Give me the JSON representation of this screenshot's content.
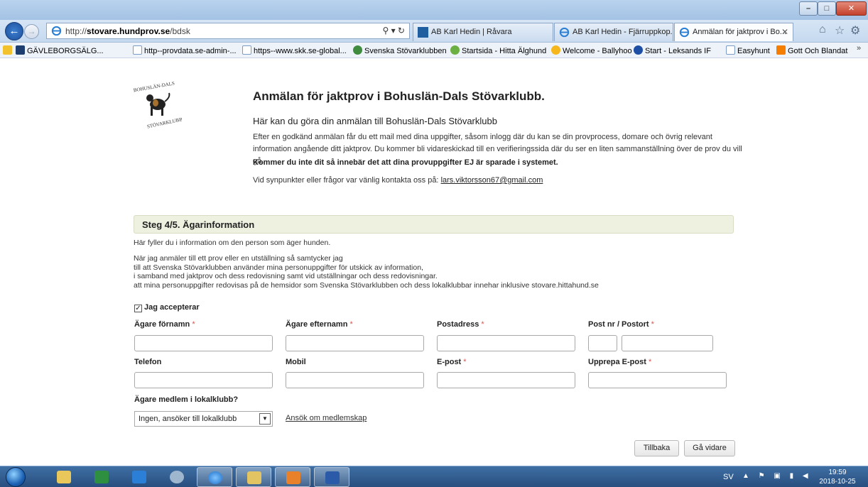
{
  "browser": {
    "url_host": "stovare.hundprov.se",
    "url_prefix": "http://",
    "url_path": "/bdsk",
    "tabs": [
      {
        "label": "AB Karl Hedin | Råvara"
      },
      {
        "label": "AB Karl Hedin - Fjärruppkop..."
      },
      {
        "label": "Anmälan för jaktprov i Bo..."
      }
    ],
    "favorites": [
      {
        "label": "GÄVLEBORGSÄLG..."
      },
      {
        "label": "http--provdata.se-admin-..."
      },
      {
        "label": "https--www.skk.se-global..."
      },
      {
        "label": "Svenska Stövarklubben"
      },
      {
        "label": "Startsida - Hitta Älghund"
      },
      {
        "label": "Welcome - Ballyhoo"
      },
      {
        "label": "Start - Leksands IF"
      },
      {
        "label": "Easyhunt"
      },
      {
        "label": "Gott Och Blandat"
      }
    ]
  },
  "page": {
    "title": "Anmälan för jaktprov i Bohuslän-Dals Stövarklubb.",
    "subtitle": "Här kan du göra din anmälan till Bohuslän-Dals Stövarklubb",
    "intro": "Efter en godkänd anmälan får du ett mail med dina uppgifter, såsom inlogg där du kan se din provprocess, domare och övrig relevant information angående ditt jaktprov. Du kommer bli vidareskickad till en verifieringssida där du ser en liten sammanställning över de prov du vill gå.",
    "warning": "Kommer du inte dit så innebär det att dina provuppgifter EJ är sparade i systemet.",
    "contact_prefix": "Vid synpunkter eller frågor var vänlig kontakta oss på: ",
    "contact_email": "lars.viktorsson67@gmail.com",
    "logo_text_top": "BOHUSLÄN-DALS",
    "logo_text_bottom": "STÖVARKLUBB"
  },
  "form": {
    "step_title": "Steg 4/5. Ägarinformation",
    "step_intro": "Här fyller du i information om den person som äger hunden.",
    "consent_lines": [
      "När jag anmäler till ett prov eller en utställning så samtycker jag",
      "till att Svenska Stövarklubben använder mina personuppgifter för utskick av information,",
      "i samband med jaktprov och dess redovisning samt vid utställningar och dess redovisningar.",
      "att mina personuppgifter redovisas på de hemsidor som Svenska Stövarklubben och dess lokalklubbar innehar inklusive stovare.hittahund.se"
    ],
    "accept_label": "Jag accepterar",
    "accept_checked": true,
    "fields": {
      "first_name": {
        "label": "Ägare förnamn",
        "required": "*",
        "value": ""
      },
      "last_name": {
        "label": "Ägare efternamn",
        "required": "*",
        "value": ""
      },
      "address": {
        "label": "Postadress",
        "required": "*",
        "value": ""
      },
      "postal": {
        "label": "Post nr / Postort",
        "required": "*",
        "value": ""
      },
      "phone": {
        "label": "Telefon",
        "required": "",
        "value": ""
      },
      "mobile": {
        "label": "Mobil",
        "required": "",
        "value": ""
      },
      "email": {
        "label": "E-post",
        "required": "*",
        "value": ""
      },
      "email_repeat": {
        "label": "Upprepa E-post",
        "required": "*",
        "value": ""
      }
    },
    "club_label": "Ägare medlem i lokalklubb?",
    "club_selected": "Ingen, ansöker till lokalklubb",
    "apply_link": "Ansök om medlemskap",
    "back_button": "Tillbaka",
    "next_button": "Gå vidare"
  },
  "taskbar": {
    "language": "SV",
    "time": "19:59",
    "date": "2018-10-25"
  },
  "colors": {
    "required_star": "#d9534f",
    "step_header_bg": "#eef1e0",
    "taskbar": "#284e7e"
  }
}
